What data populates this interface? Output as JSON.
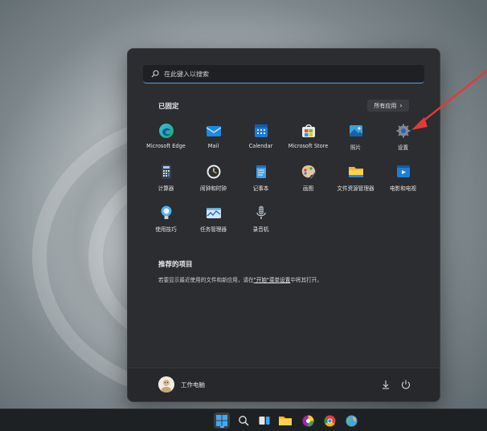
{
  "search": {
    "placeholder": "在此键入以搜索",
    "icon": "search-icon"
  },
  "pinned": {
    "title": "已固定",
    "all_apps_label": "所有应用",
    "apps": [
      {
        "label": "Microsoft Edge",
        "icon": "edge-icon"
      },
      {
        "label": "Mail",
        "icon": "mail-icon"
      },
      {
        "label": "Calendar",
        "icon": "calendar-icon"
      },
      {
        "label": "Microsoft Store",
        "icon": "store-icon"
      },
      {
        "label": "照片",
        "icon": "photos-icon"
      },
      {
        "label": "设置",
        "icon": "settings-gear-icon"
      },
      {
        "label": "计算器",
        "icon": "calculator-icon"
      },
      {
        "label": "闹钟和时钟",
        "icon": "clock-icon"
      },
      {
        "label": "记事本",
        "icon": "notepad-icon"
      },
      {
        "label": "画图",
        "icon": "paint-icon"
      },
      {
        "label": "文件资源管理器",
        "icon": "folder-icon"
      },
      {
        "label": "电影和电视",
        "icon": "movies-icon"
      },
      {
        "label": "使用技巧",
        "icon": "tips-icon"
      },
      {
        "label": "任务管理器",
        "icon": "task-manager-icon"
      },
      {
        "label": "录音机",
        "icon": "recorder-icon"
      }
    ]
  },
  "recommended": {
    "title": "推荐的项目",
    "text": "若要显示最近使用的文件和新应用，请在",
    "link": "\"开始\"菜单设置",
    "suffix": "中将其打开。"
  },
  "user": {
    "name": "工作电脑"
  },
  "taskbar": {
    "items": [
      "start-icon",
      "search-icon",
      "task-view-icon",
      "file-explorer-icon",
      "colorful-app-icon",
      "chrome-icon",
      "globe-app-icon"
    ]
  },
  "colors": {
    "accent": "#5fb2ff",
    "menu_bg": "#2b2d30",
    "arrow": "#e53935"
  }
}
